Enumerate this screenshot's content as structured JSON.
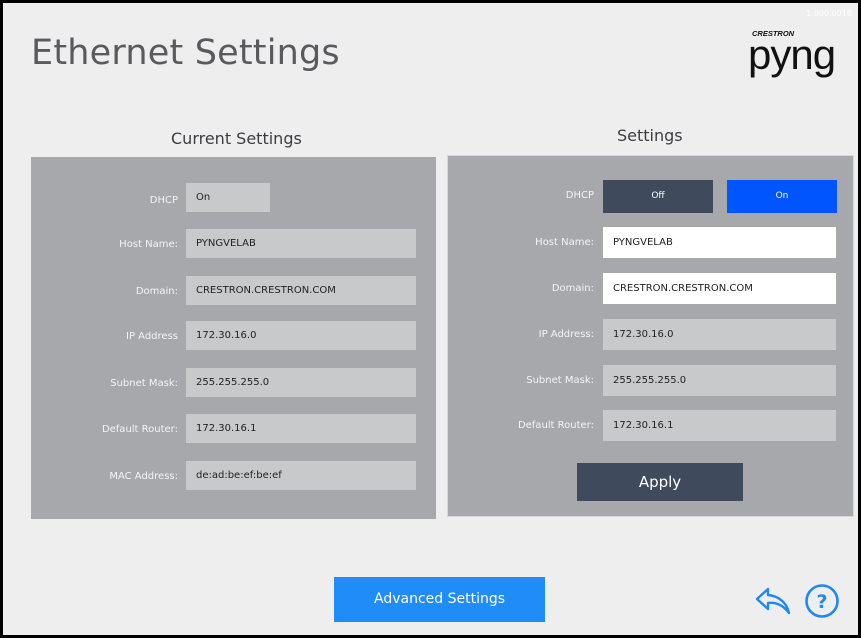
{
  "header": {
    "title": "Ethernet Settings",
    "version": "1.000.0018",
    "logo_brand_small": "CRESTRON",
    "logo_brand_big": "pyng"
  },
  "current_settings": {
    "title": "Current Settings",
    "dhcp": {
      "label": "DHCP",
      "value": "On"
    },
    "host_name": {
      "label": "Host Name:",
      "value": "PYNGVELAB"
    },
    "domain": {
      "label": "Domain:",
      "value": "CRESTRON.CRESTRON.COM"
    },
    "ip_address": {
      "label": "IP Address",
      "value": "172.30.16.0"
    },
    "subnet_mask": {
      "label": "Subnet Mask:",
      "value": "255.255.255.0"
    },
    "default_router": {
      "label": "Default Router:",
      "value": "172.30.16.1"
    },
    "mac_address": {
      "label": "MAC Address:",
      "value": "de:ad:be:ef:be:ef"
    }
  },
  "settings": {
    "title": "Settings",
    "dhcp": {
      "label": "DHCP",
      "off_label": "Off",
      "on_label": "On",
      "selected": "On"
    },
    "host_name": {
      "label": "Host Name:",
      "value": "PYNGVELAB"
    },
    "domain": {
      "label": "Domain:",
      "value": "CRESTRON.CRESTRON.COM"
    },
    "ip_address": {
      "label": "IP Address:",
      "value": "172.30.16.0"
    },
    "subnet_mask": {
      "label": "Subnet Mask:",
      "value": "255.255.255.0"
    },
    "default_router": {
      "label": "Default Router:",
      "value": "172.30.16.1"
    },
    "apply_label": "Apply"
  },
  "footer": {
    "advanced_label": "Advanced Settings",
    "back_icon": "back-arrow-icon",
    "help_icon": "help-icon"
  },
  "colors": {
    "background": "#eeeeef",
    "panel": "#a6a8ab",
    "field": "#c8c9cb",
    "dark_button": "#3f4a5d",
    "selected_blue": "#0055ff",
    "advanced_blue": "#1f8cf8",
    "icon_blue": "#1e88f5"
  }
}
